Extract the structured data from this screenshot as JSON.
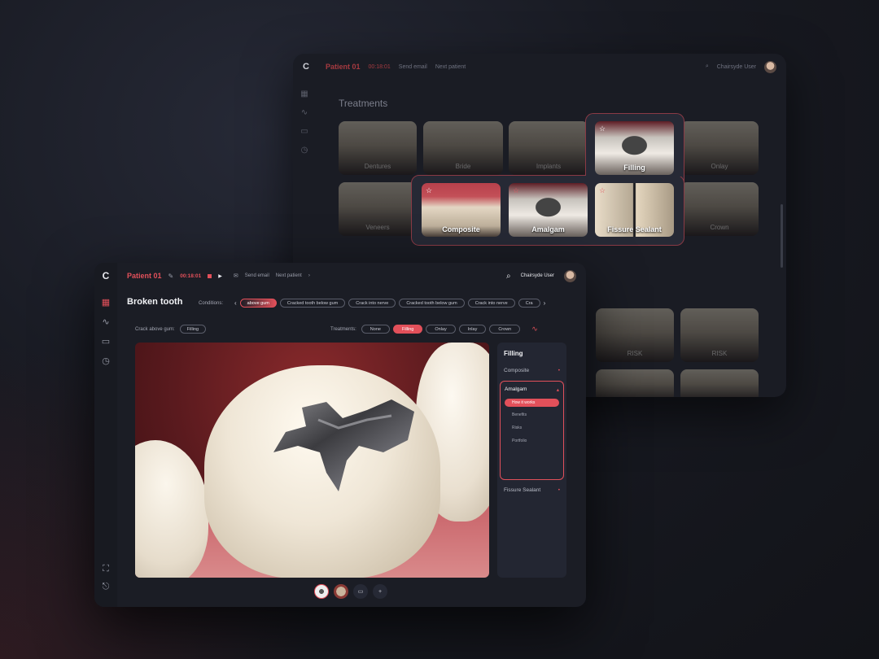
{
  "back": {
    "patient": "Patient 01",
    "timer": "00:18:01",
    "send_email": "Send email",
    "next_patient": "Next patient",
    "user": "Chairsyde User",
    "section_title": "Treatments",
    "tiles": [
      "Dentures",
      "Bride",
      "Implants",
      "Onlay",
      "Veneers",
      "Crown",
      "RISK",
      "RISK"
    ],
    "popover": {
      "selected": "Filling",
      "options": [
        "Composite",
        "Amalgam",
        "Fissure Sealant"
      ]
    }
  },
  "front": {
    "logo": "C",
    "patient": "Patient 01",
    "timer": "00:18:01",
    "send_email": "Send email",
    "next_patient": "Next patient",
    "user": "Chairsyde User",
    "title": "Broken tooth",
    "conditions_label": "Conditions:",
    "conditions": [
      "above gum",
      "Cracked tooth below gum",
      "Crack into nerve",
      "Cracked tooth below gum",
      "Crack into nerve",
      "Cra"
    ],
    "crack_label": "Crack above gum:",
    "crack_value": "Filling",
    "treatments_label": "Treatments:",
    "treatments": [
      "None",
      "Filling",
      "Onlay",
      "Inlay",
      "Crown"
    ],
    "panel": {
      "title": "Filling",
      "items": [
        "Composite",
        "Amalgam",
        "Fissure Sealant"
      ],
      "active_sub": "How it works",
      "subs": [
        "Benefits",
        "Risks",
        "Portfolio"
      ]
    }
  },
  "colors": {
    "accent": "#e2505a",
    "bg": "#1b1d25"
  }
}
